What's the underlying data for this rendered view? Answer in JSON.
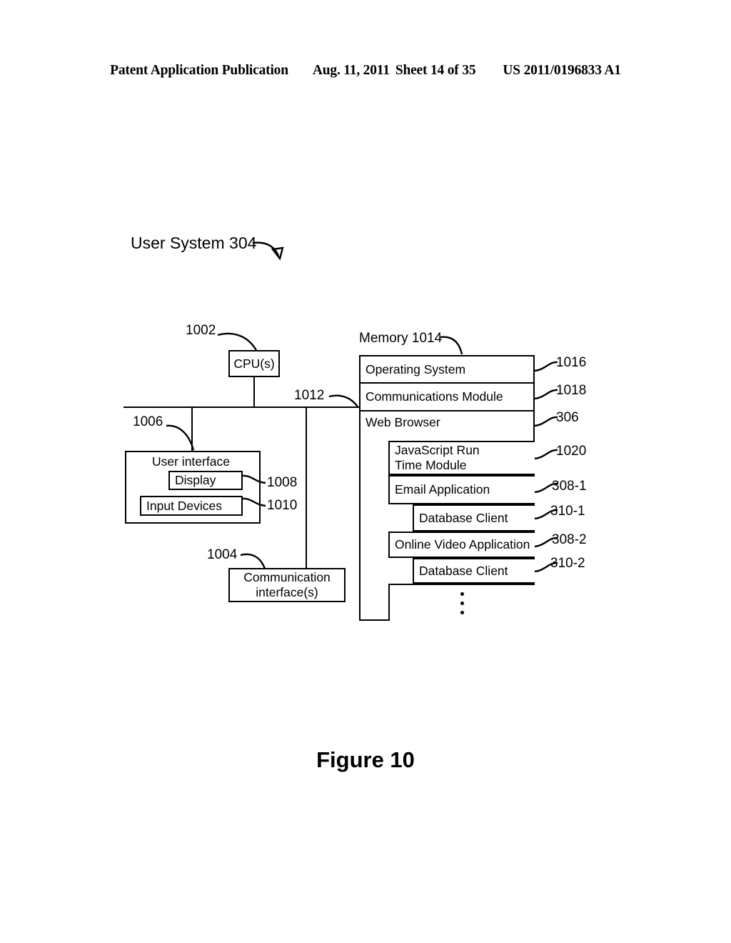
{
  "header": {
    "publication": "Patent Application Publication",
    "date": "Aug. 11, 2011",
    "sheet": "Sheet 14 of 35",
    "number": "US 2011/0196833 A1"
  },
  "title": "User System 304",
  "figure_caption": "Figure 10",
  "blocks": {
    "cpu": {
      "label": "CPU(s)",
      "ref": "1002"
    },
    "user_interface": {
      "label": "User interface",
      "ref": "1006"
    },
    "display": {
      "label": "Display",
      "ref": "1008"
    },
    "input_devices": {
      "label": "Input Devices",
      "ref": "1010"
    },
    "communication_interfaces": {
      "label": "Communication interface(s)",
      "line1": "Communication",
      "line2": "interface(s)",
      "ref": "1004"
    },
    "bus": {
      "ref": "1012"
    }
  },
  "memory": {
    "label": "Memory 1014",
    "rows": [
      {
        "label": "Operating System",
        "ref": "1016"
      },
      {
        "label": "Communications Module",
        "ref": "1018"
      },
      {
        "label": "Web Browser",
        "ref": "306"
      }
    ],
    "browser_children": [
      {
        "label": "JavaScript Run Time Module",
        "line1": "JavaScript Run",
        "line2": "Time Module",
        "ref": "1020"
      },
      {
        "label": "Email Application",
        "ref": "308-1"
      },
      {
        "label": "Database Client",
        "ref": "310-1"
      },
      {
        "label": "Online Video Application",
        "ref": "308-2"
      },
      {
        "label": "Database Client",
        "ref": "310-2"
      }
    ],
    "more_indicator": "vertical-ellipsis"
  }
}
